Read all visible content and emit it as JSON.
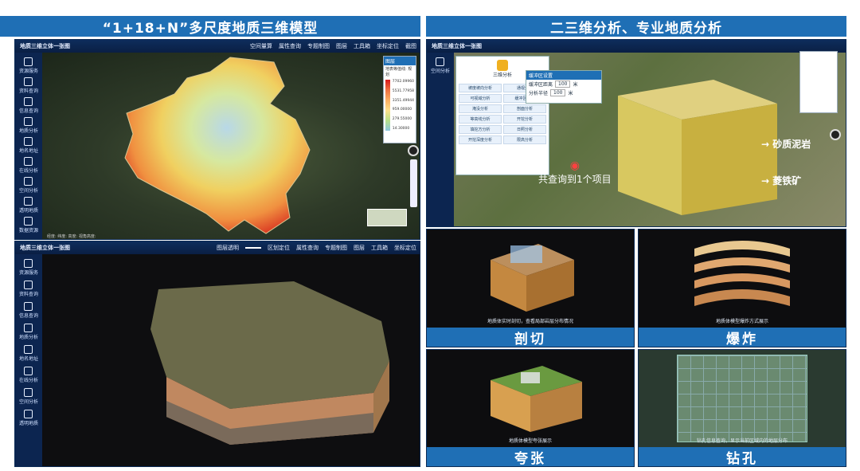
{
  "left_banner": "“1+18+N”多尺度地质三维模型",
  "right_banner": "二三维分析、专业地质分析",
  "top_map": {
    "window_title": "地质三维立体一张图",
    "toolbar": [
      "空间量算",
      "属性查询",
      "专题制图",
      "图层",
      "工具箱",
      "坐标定位",
      "截图"
    ],
    "sidebar": [
      "资源服务",
      "资料查询",
      "信息查询",
      "地质分析",
      "地名地址",
      "在线分析",
      "空间分析",
      "透明地质",
      "数据资源"
    ],
    "legend_title": "图层",
    "legend_subtitle": "地表等值线: 规划",
    "legend_values": [
      "7702.09960",
      "5531.77958",
      "3351.49944",
      "959.00000",
      "279.55000",
      "14.30000"
    ],
    "legend_colors": [
      "#d7191c",
      "#f07040",
      "#fdae61",
      "#fee08b",
      "#b8e08a",
      "#8cc7e0"
    ],
    "status": "经度:  纬度:  高度:  视角高度:"
  },
  "bottom_map": {
    "window_title": "地质三维立体一张图",
    "toolbar": [
      "图层透明",
      "区划定位",
      "属性查询",
      "专题制图",
      "图层",
      "工具箱",
      "坐标定位"
    ],
    "sidebar": [
      "资源服务",
      "资料查询",
      "信息查询",
      "地质分析",
      "地名地址",
      "在线分析",
      "空间分析",
      "透明地质"
    ]
  },
  "analysis_panel": {
    "window_title": "地质三维立体一张图",
    "side_menu": [
      "空间分析"
    ],
    "dialog_title": "三维分析",
    "buttons": [
      "坡度坡向分析",
      "通视分析",
      "可视域分析",
      "缓冲区分析",
      "淹没分析",
      "剖面分析",
      "等高线分析",
      "开挖分析",
      "填挖方分析",
      "日照分析",
      "开挖深度分析",
      "限高分析"
    ],
    "settings_title": "缓冲区设置",
    "settings_rows": [
      {
        "label": "缓冲区距离",
        "value": "100",
        "unit": "米"
      },
      {
        "label": "分析半径",
        "value": "100",
        "unit": "米"
      }
    ],
    "query_result": "共查询到1个项目",
    "label_sand": "砂质泥岩",
    "label_siderite": "菱铁矿"
  },
  "tiles": [
    {
      "caption": "剖切",
      "subcaption": "地质体实时剖切，查看局部岩层分布情况"
    },
    {
      "caption": "爆炸",
      "subcaption": "地质体模型爆炸方式展示"
    },
    {
      "caption": "夸张",
      "subcaption": "地质体模型夸张展示"
    },
    {
      "caption": "钻孔",
      "subcaption": "钻孔信息查询，显示当前区域内的地层分布"
    }
  ]
}
